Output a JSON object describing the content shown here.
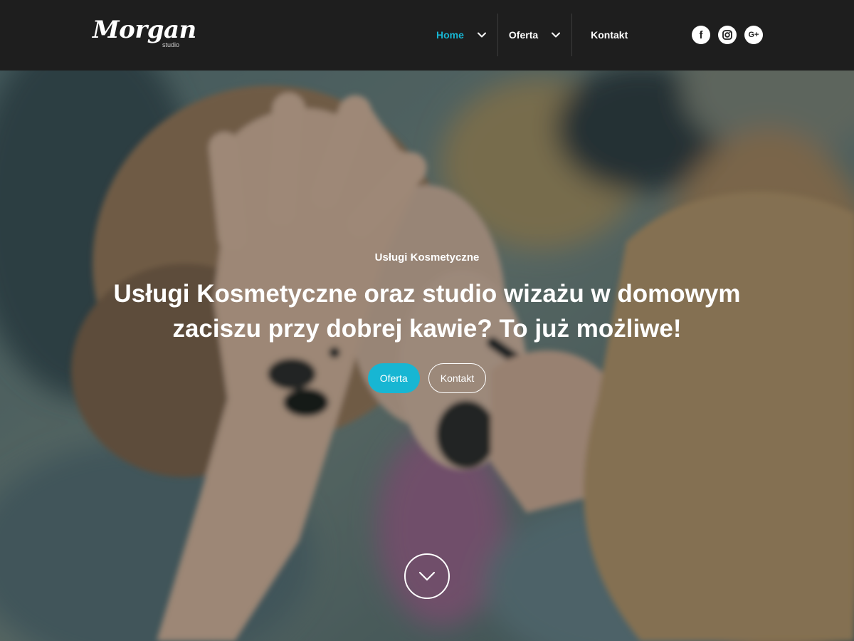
{
  "brand": {
    "name": "Morgan",
    "subtitle": "studio"
  },
  "nav": {
    "items": [
      {
        "label": "Home",
        "active": true,
        "has_dropdown": true
      },
      {
        "label": "Oferta",
        "active": false,
        "has_dropdown": true
      },
      {
        "label": "Kontakt",
        "active": false,
        "has_dropdown": false
      }
    ]
  },
  "social": [
    {
      "icon": "facebook-icon",
      "glyph": "f"
    },
    {
      "icon": "instagram-icon",
      "glyph": ""
    },
    {
      "icon": "google-plus-icon",
      "glyph": "G+"
    }
  ],
  "hero": {
    "eyebrow": "Usługi Kosmetyczne",
    "title": "Usługi Kosmetyczne oraz studio wizażu w domowym zaciszu przy dobrej kawie? To już możliwe!",
    "primary_button": "Oferta",
    "secondary_button": "Kontakt",
    "scroll_icon": "chevron-down-icon"
  },
  "colors": {
    "accent": "#17b6d3",
    "header_bg": "#1e1e1e",
    "text": "#ffffff"
  }
}
